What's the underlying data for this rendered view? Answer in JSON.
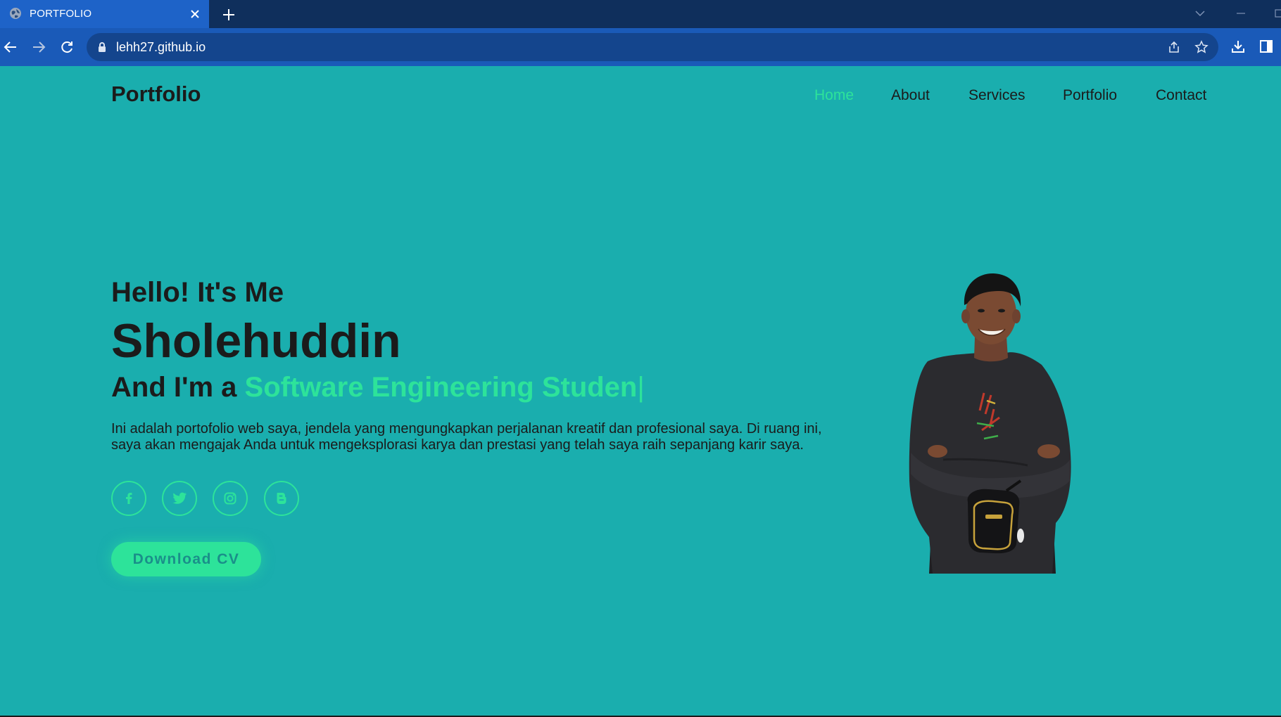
{
  "browser": {
    "tab_title": "PORTFOLIO",
    "url": "lehh27.github.io"
  },
  "site": {
    "logo": "Portfolio",
    "nav": [
      {
        "label": "Home",
        "active": true
      },
      {
        "label": "About",
        "active": false
      },
      {
        "label": "Services",
        "active": false
      },
      {
        "label": "Portfolio",
        "active": false
      },
      {
        "label": "Contact",
        "active": false
      }
    ]
  },
  "hero": {
    "greeting": "Hello! It's Me",
    "name": "Sholehuddin",
    "role_prefix": "And I'm a ",
    "role_typed": "Software Engineering Studen",
    "caret": "|",
    "description": "Ini adalah portofolio web saya, jendela yang mengungkapkan perjalanan kreatif dan profesional saya. Di ruang ini, saya akan mengajak Anda untuk mengeksplorasi karya dan prestasi yang telah saya raih sepanjang karir saya.",
    "socials": [
      "facebook-icon",
      "twitter-icon",
      "instagram-icon",
      "blogger-icon"
    ],
    "cv_button": "Download CV"
  },
  "colors": {
    "page_bg": "#1aaeae",
    "accent": "#2de39a",
    "text": "#1b1b1b",
    "tab_bar": "#0f2f5c",
    "toolbar": "#1a5ab8"
  }
}
